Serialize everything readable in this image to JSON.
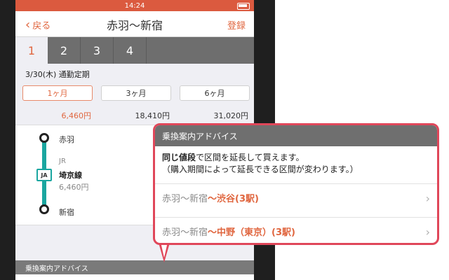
{
  "status": {
    "time": "14:24"
  },
  "nav": {
    "back_label": "戻る",
    "title": "赤羽〜新宿",
    "register_label": "登録"
  },
  "tabs": [
    "1",
    "2",
    "3",
    "4"
  ],
  "pass": {
    "date_label": "3/30(木) 通勤定期",
    "periods": [
      "1ヶ月",
      "3ヶ月",
      "6ヶ月"
    ],
    "prices": [
      "6,460円",
      "18,410円",
      "31,020円"
    ]
  },
  "route": {
    "from": "赤羽",
    "to": "新宿",
    "operator": "JR",
    "line": "埼京線",
    "fare": "6,460円",
    "badge": "JA",
    "line_color": "#1aa6a0"
  },
  "bottom_section_title": "乗換案内アドバイス",
  "popup": {
    "title": "乗換案内アドバイス",
    "desc_bold": "同じ値段",
    "desc_rest": "で区間を延長して買えます。",
    "desc_line2": "（購入期間によって延長できる区間が変わります。）",
    "options": [
      {
        "base": "赤羽〜新宿",
        "ext": "〜渋谷(3駅)"
      },
      {
        "base": "赤羽〜新宿",
        "ext": "〜中野（東京）(3駅)"
      }
    ]
  },
  "colors": {
    "accent": "#e0663f",
    "popup_border": "#e0475a"
  }
}
